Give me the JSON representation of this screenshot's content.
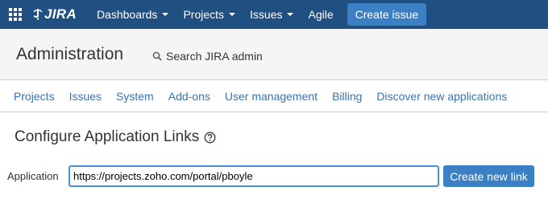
{
  "topnav": {
    "logo_text": "JIRA",
    "items": [
      {
        "label": "Dashboards",
        "has_dropdown": true
      },
      {
        "label": "Projects",
        "has_dropdown": true
      },
      {
        "label": "Issues",
        "has_dropdown": true
      },
      {
        "label": "Agile",
        "has_dropdown": false
      }
    ],
    "create_label": "Create issue",
    "background_color": "#205081",
    "button_color": "#3b7fc4"
  },
  "admin_header": {
    "title": "Administration",
    "search_label": "Search JIRA admin"
  },
  "admin_tabs": [
    "Projects",
    "Issues",
    "System",
    "Add-ons",
    "User management",
    "Billing",
    "Discover new applications"
  ],
  "content": {
    "heading": "Configure Application Links",
    "form": {
      "label": "Application",
      "input_value": "https://projects.zoho.com/portal/pboyle",
      "submit_label": "Create new link"
    }
  },
  "icons": {
    "app_switcher": "app-switcher-icon",
    "logo": "jira-logo-icon",
    "search": "search-icon",
    "help": "help-icon"
  },
  "colors": {
    "link": "#3b73af",
    "input_focus": "#4a90d9",
    "header_bg": "#f5f5f5"
  }
}
